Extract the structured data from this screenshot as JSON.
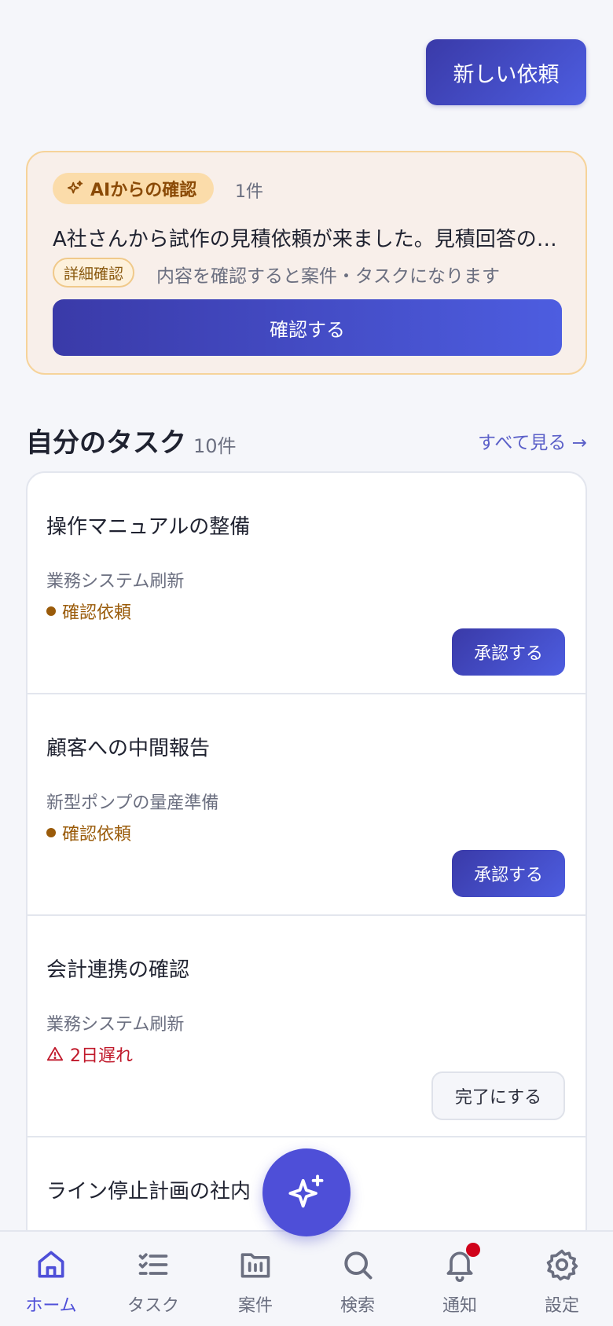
{
  "header": {
    "new_request_label": "新しい依頼"
  },
  "ai_card": {
    "badge_label": "AIからの確認",
    "count": "1件",
    "message": "A社さんから試作の見積依頼が来ました。見積回答の準備をお願いします。",
    "detail_tag": "詳細確認",
    "detail_note": "内容を確認すると案件・タスクになります",
    "confirm_label": "確認する"
  },
  "tasks_section": {
    "title": "自分のタスク",
    "count": "10件",
    "see_all": "すべて見る →"
  },
  "tasks": [
    {
      "title": "操作マニュアルの整備",
      "project": "業務システム刷新",
      "status": "確認依頼",
      "status_type": "review",
      "action": "承認する"
    },
    {
      "title": "顧客への中間報告",
      "project": "新型ポンプの量産準備",
      "status": "確認依頼",
      "status_type": "review",
      "action": "承認する"
    },
    {
      "title": "会計連携の確認",
      "project": "業務システム刷新",
      "status": "2日遅れ",
      "status_type": "overdue",
      "action": "完了にする"
    },
    {
      "title": "ライン停止計画の社内"
    }
  ],
  "colors": {
    "review": "#9a5b0a",
    "overdue": "#c0182a",
    "accent": "#4e4fd8"
  },
  "bottom_nav": {
    "items": [
      {
        "label": "ホーム",
        "icon": "home-icon",
        "active": true
      },
      {
        "label": "タスク",
        "icon": "task-list-icon"
      },
      {
        "label": "案件",
        "icon": "folder-icon"
      },
      {
        "label": "検索",
        "icon": "search-icon"
      },
      {
        "label": "通知",
        "icon": "bell-icon",
        "has_badge": true
      },
      {
        "label": "設定",
        "icon": "gear-icon"
      }
    ]
  }
}
